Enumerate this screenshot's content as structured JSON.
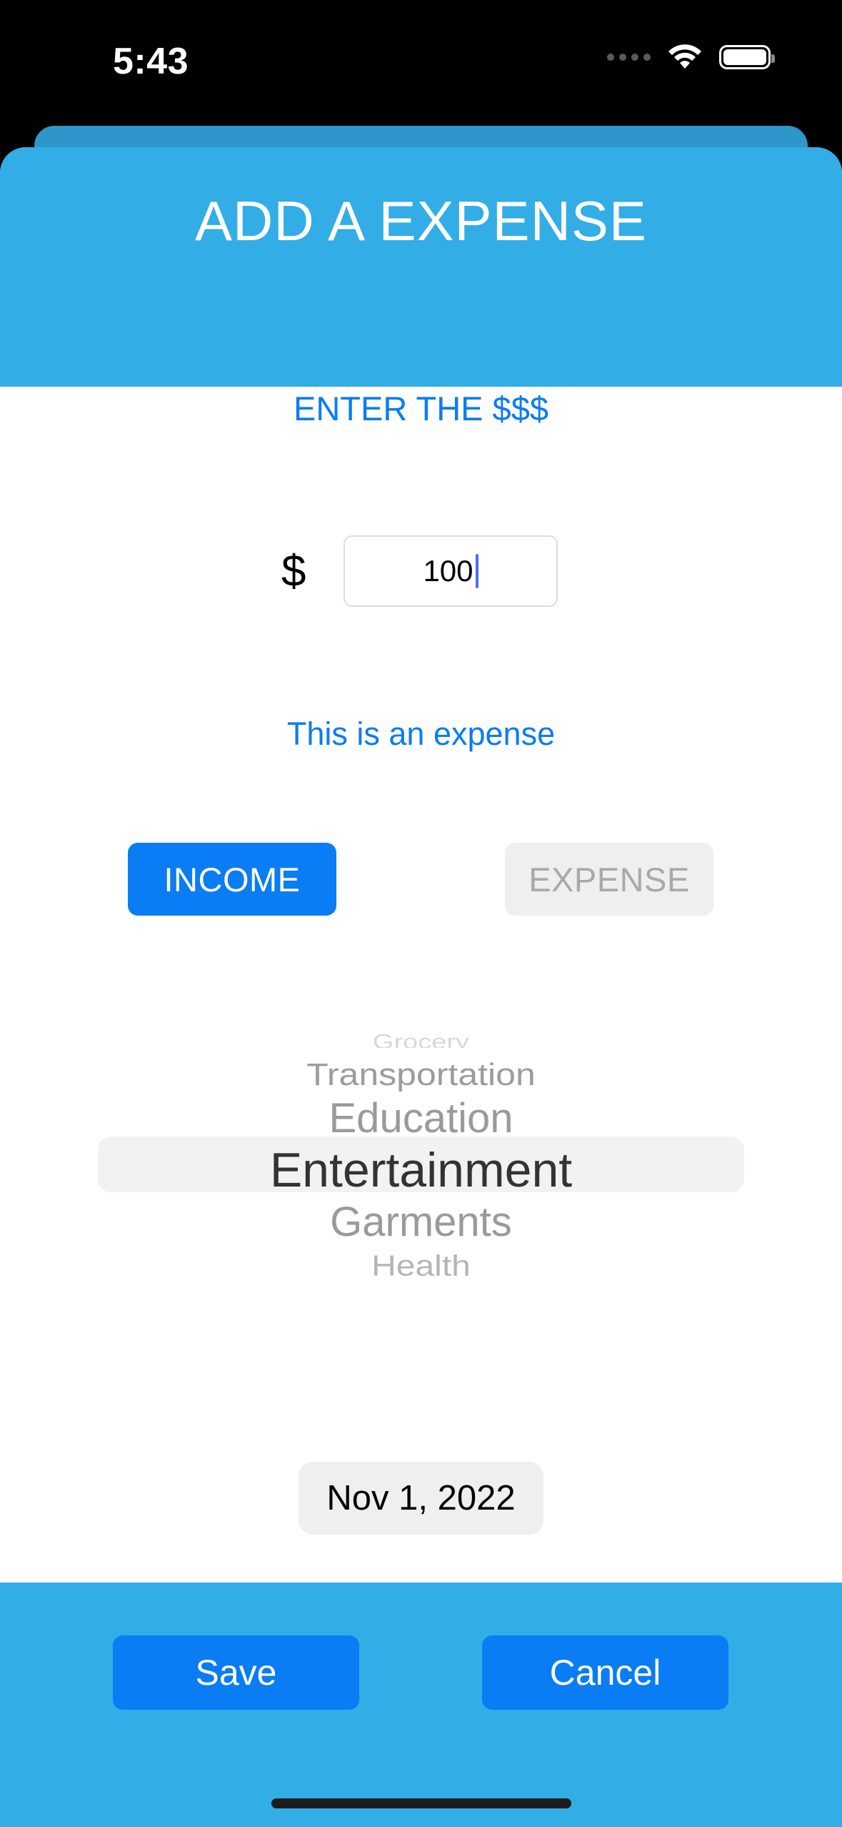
{
  "status_bar": {
    "time": "5:43"
  },
  "header": {
    "title": "ADD A EXPENSE"
  },
  "form": {
    "enter_label": "ENTER THE $$$",
    "currency_symbol": "$",
    "amount_value": "100",
    "type_note": "This is an expense",
    "income_label": "INCOME",
    "expense_label": "EXPENSE"
  },
  "category_picker": {
    "items": [
      "Grocery",
      "Transportation",
      "Education",
      "Entertainment",
      "Garments",
      "Health"
    ],
    "selected": "Entertainment"
  },
  "date": {
    "label": "Nov 1, 2022"
  },
  "footer": {
    "save_label": "Save",
    "cancel_label": "Cancel"
  },
  "colors": {
    "header_blue": "#32ade6",
    "accent_blue": "#0a7cf4",
    "disabled_gray": "#efefef"
  },
  "icons": {
    "signal": "cellular-signal-icon",
    "wifi": "wifi-icon",
    "battery": "battery-icon"
  }
}
